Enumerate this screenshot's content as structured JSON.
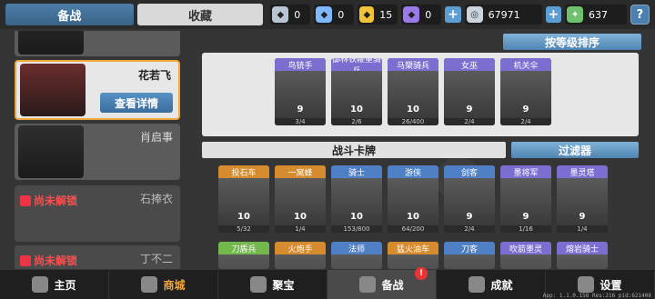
{
  "tabs": {
    "active": "备战",
    "inactive": "收藏"
  },
  "resources": [
    {
      "icon": "silver-gem-icon",
      "value": "0",
      "color": "#b8c6d4"
    },
    {
      "icon": "blue-gem-icon",
      "value": "0",
      "color": "#7fb8ff"
    },
    {
      "icon": "gold-gem-icon",
      "value": "15",
      "color": "#f2c23a"
    },
    {
      "icon": "purple-gem-icon",
      "value": "0",
      "color": "#9a7ae8"
    }
  ],
  "currency": {
    "coins": "67971",
    "gems": "637",
    "plus": "+",
    "help": "?"
  },
  "heroes": [
    {
      "name": "",
      "locked": false
    },
    {
      "name": "花若飞",
      "selected": true,
      "detail_label": "查看详情"
    },
    {
      "name": "肖启事"
    },
    {
      "name": "石捧衣",
      "lock_label": "尚未解锁"
    },
    {
      "name": "丁不二",
      "lock_label": "尚未解锁"
    }
  ],
  "sort_label": "按等级排序",
  "team_cards": [
    {
      "name": "鸟铳手",
      "level": "9",
      "count": "3/4",
      "rarity": "purple"
    },
    {
      "name": "御林铁鞭重骑兵",
      "level": "10",
      "count": "2/6",
      "rarity": "purple"
    },
    {
      "name": "马槊骑兵",
      "level": "10",
      "count": "26/400",
      "rarity": "purple"
    },
    {
      "name": "女巫",
      "level": "9",
      "count": "2/4",
      "rarity": "purple"
    },
    {
      "name": "机关伞",
      "level": "9",
      "count": "2/4",
      "rarity": "purple"
    }
  ],
  "section_title": "战斗卡牌",
  "filter_label": "过滤器",
  "battle_cards_row1": [
    {
      "name": "投石车",
      "level": "10",
      "count": "5/32",
      "rarity": "orange"
    },
    {
      "name": "一窝蜂",
      "level": "10",
      "count": "1/4",
      "rarity": "orange"
    },
    {
      "name": "骑士",
      "level": "10",
      "count": "153/800",
      "rarity": "blue"
    },
    {
      "name": "游侠",
      "level": "10",
      "count": "64/200",
      "rarity": "blue"
    },
    {
      "name": "剑客",
      "level": "9",
      "count": "2/4",
      "rarity": "blue"
    },
    {
      "name": "墨将军",
      "level": "9",
      "count": "1/16",
      "rarity": "purple"
    },
    {
      "name": "墨灵塔",
      "level": "9",
      "count": "1/4",
      "rarity": "purple"
    }
  ],
  "battle_cards_row2": [
    {
      "name": "刀盾兵",
      "rarity": "green"
    },
    {
      "name": "火炮手",
      "rarity": "orange"
    },
    {
      "name": "法师",
      "rarity": "blue"
    },
    {
      "name": "猛火油车",
      "rarity": "orange"
    },
    {
      "name": "刀客",
      "rarity": "blue"
    },
    {
      "name": "吹箭墨灵",
      "rarity": "purple"
    },
    {
      "name": "熔岩骑士",
      "rarity": "purple"
    }
  ],
  "nav": [
    {
      "label": "主页",
      "icon": "home-icon"
    },
    {
      "label": "商城",
      "icon": "shop-icon",
      "store": true
    },
    {
      "label": "聚宝",
      "icon": "treasure-icon"
    },
    {
      "label": "备战",
      "icon": "cards-icon",
      "active": true,
      "badge": "!"
    },
    {
      "label": "成就",
      "icon": "achievement-icon"
    },
    {
      "label": "设置",
      "icon": "gear-icon"
    }
  ],
  "version": "App: 1.1.0.158 Res:216 pid:621408"
}
